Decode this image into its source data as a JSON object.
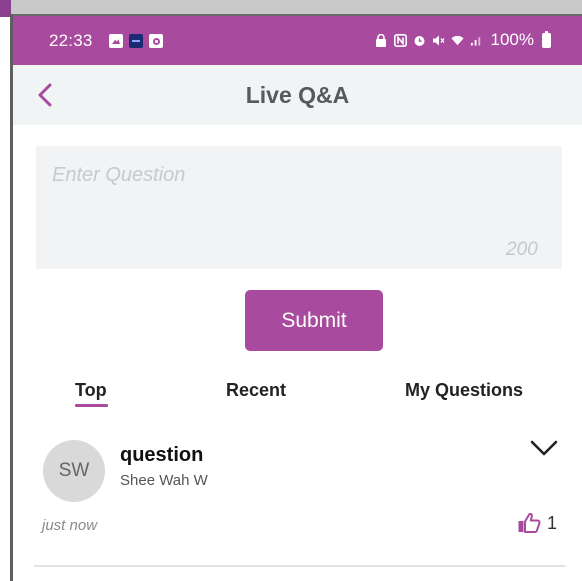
{
  "status_bar": {
    "time": "22:33",
    "battery": "100%"
  },
  "header": {
    "title": "Live Q&A"
  },
  "question_input": {
    "placeholder": "Enter Question",
    "char_limit": "200"
  },
  "submit_label": "Submit",
  "tabs": [
    {
      "label": "Top",
      "active": true
    },
    {
      "label": "Recent",
      "active": false
    },
    {
      "label": "My Questions",
      "active": false
    }
  ],
  "questions": [
    {
      "initials": "SW",
      "text": "question",
      "author": "Shee Wah W",
      "time": "just now",
      "likes": "1"
    }
  ],
  "colors": {
    "accent": "#a84a9e",
    "header_bg": "#f1f4f5"
  },
  "icons": {
    "back": "chevron-left-icon",
    "expand": "chevron-down-icon",
    "like": "thumbs-up-icon"
  }
}
